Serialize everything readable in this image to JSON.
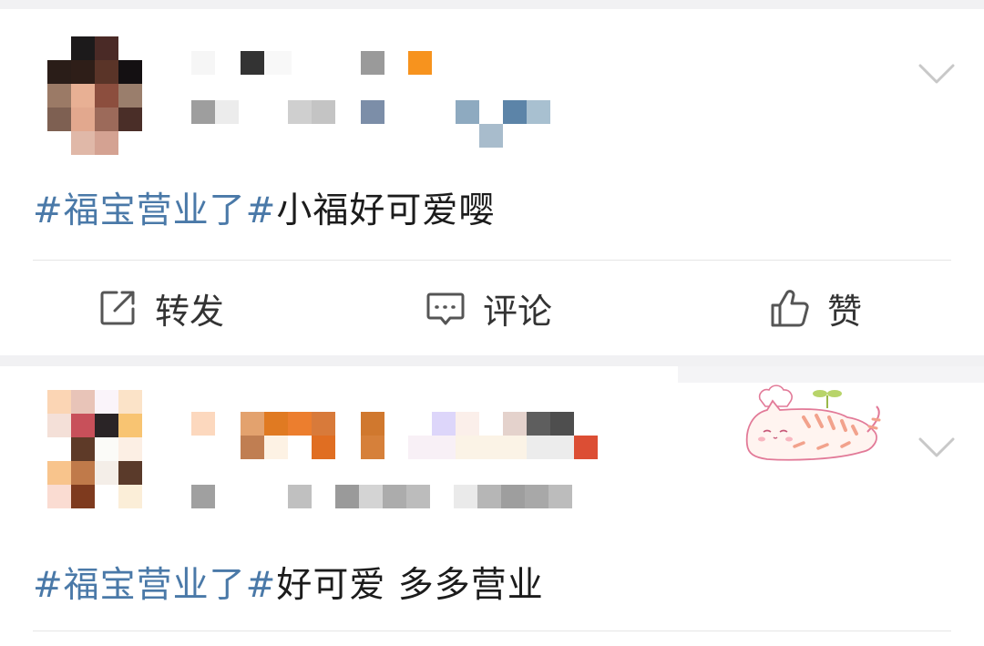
{
  "posts": [
    {
      "hashtag": "#福宝营业了#",
      "body": "小福好可爱嘤"
    },
    {
      "hashtag": "#福宝营业了#",
      "body": "好可爱 多多营业"
    }
  ],
  "actions": {
    "repost": "转发",
    "comment": "评论",
    "like": "赞"
  },
  "icons": {
    "repost": "share-square-arrow-icon",
    "comment": "speech-bubble-icon",
    "like": "thumbs-up-icon",
    "expand": "chevron-down-icon",
    "sticker": "cat-sticker-icon"
  },
  "colors": {
    "hashtag": "#4a79a8",
    "text": "#1c1c1c",
    "background": "#f1f1f3",
    "card": "#ffffff"
  }
}
